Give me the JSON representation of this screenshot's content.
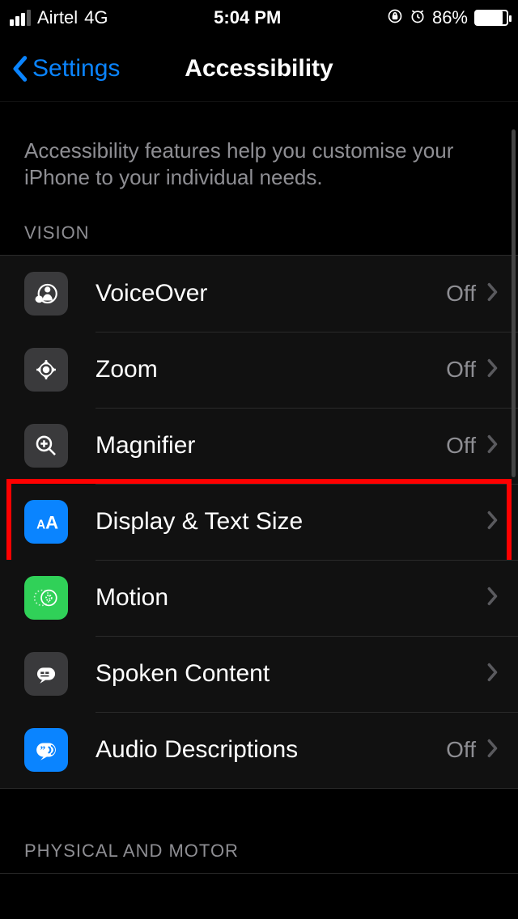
{
  "status": {
    "carrier": "Airtel",
    "network": "4G",
    "time": "5:04 PM",
    "battery_percent": "86%"
  },
  "nav": {
    "back_label": "Settings",
    "title": "Accessibility"
  },
  "description": "Accessibility features help you customise your iPhone to your individual needs.",
  "sections": {
    "vision": {
      "header": "VISION",
      "items": [
        {
          "label": "VoiceOver",
          "value": "Off"
        },
        {
          "label": "Zoom",
          "value": "Off"
        },
        {
          "label": "Magnifier",
          "value": "Off"
        },
        {
          "label": "Display & Text Size",
          "value": ""
        },
        {
          "label": "Motion",
          "value": ""
        },
        {
          "label": "Spoken Content",
          "value": ""
        },
        {
          "label": "Audio Descriptions",
          "value": "Off"
        }
      ]
    },
    "physical": {
      "header": "PHYSICAL AND MOTOR"
    }
  }
}
